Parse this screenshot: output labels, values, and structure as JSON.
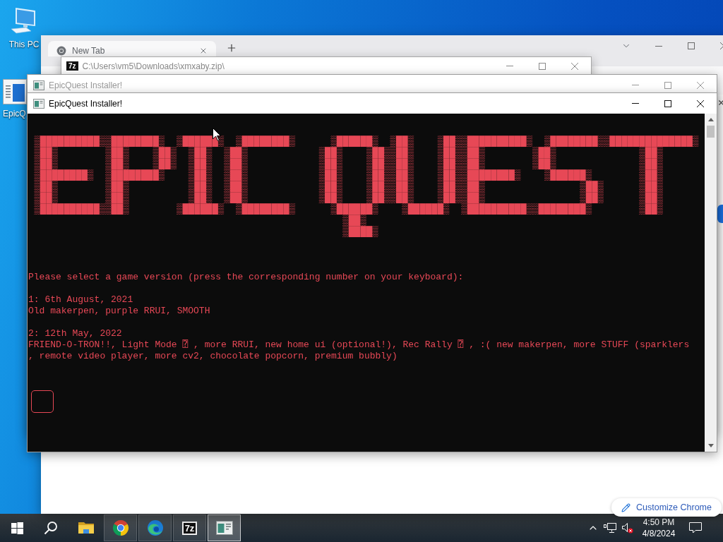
{
  "desktop": {
    "icons": [
      {
        "kind": "computer",
        "label": "This PC"
      },
      {
        "kind": "app",
        "label": "EpicQ"
      }
    ]
  },
  "browser_window": {
    "tabs": [
      {
        "title": "New Tab",
        "selected": true
      }
    ],
    "customize_button": "Customize Chrome"
  },
  "archive_window": {
    "icon_label": "7z",
    "title": "C:\\Users\\vm5\\Downloads\\xmxaby.zip\\",
    "active": false
  },
  "installer_windows": [
    {
      "title": "EpicQuest Installer!",
      "active": false
    },
    {
      "title": "EpicQuest Installer!",
      "active": true,
      "console": {
        "banner": [
          " ▒██████████▒▒████████▒  ▒██████▒  ▒████████▒      ▒██████▒  ▒██▒    ▒██▒▒██████████▒  ▒████████▒▒██████████████▒",
          " ▒██▒        ▒██▒    ▒██▒  ▒██▒  ▒██▒            ▒██▒    ▒██▒▒██▒    ▒██▒▒██▒        ▒██▒              ▒██▒",
          " ▒██▒        ▒██▒    ▒██▒  ▒██▒  ▒██▒            ▒██▒    ▒██▒▒██▒    ▒██▒▒██▒        ▒██▒              ▒██▒",
          " ▒████████▒  ▒████████▒    ▒██▒  ▒██▒            ▒██▒    ▒██▒▒██▒    ▒██▒▒████████▒    ▒██████▒        ▒██▒",
          " ▒██▒        ▒██▒          ▒██▒  ▒██▒            ▒██▒    ▒██▒▒██▒    ▒██▒▒██▒                ▒██▒      ▒██▒",
          " ▒██▒        ▒██▒          ▒██▒  ▒██▒            ▒██▒    ▒██▒▒██▒    ▒██▒▒██▒                ▒██▒      ▒██▒",
          " ▒██████████▒▒██▒        ▒██████▒  ▒████████▒      ▒██████▒    ▒██████▒  ▒██████████▒▒████████▒        ▒██▒",
          "                                                     ▒██▒",
          "                                                     ▒████▒"
        ],
        "prompt": "Please select a game version (press the corresponding number on your keyboard):",
        "versions": [
          {
            "heading": "1: 6th August, 2021",
            "lines": [
              "Old makerpen, purple RRUI, SMOOTH"
            ]
          },
          {
            "heading": "2: 12th May, 2022",
            "lines": [
              "FRIEND-O-TRON!!, Light Mode ⍰ , more RRUI, new home ui (optional!), Rec Rally ⍰ , :( new makerpen, more STUFF (sparklers",
              ", remote video player, more cv2, chocolate popcorn, premium bubbly)"
            ]
          }
        ]
      }
    }
  ],
  "taskbar": {
    "apps": [
      {
        "kind": "folder",
        "open": false,
        "selected": false
      },
      {
        "kind": "ring",
        "open": true,
        "selected": false
      },
      {
        "kind": "swirl",
        "open": true,
        "selected": false
      },
      {
        "kind": "archive",
        "label": "7z",
        "open": true,
        "selected": false
      },
      {
        "kind": "console",
        "open": true,
        "selected": true
      }
    ],
    "clock": {
      "time": "4:50 PM",
      "date": "4/8/2024"
    }
  }
}
